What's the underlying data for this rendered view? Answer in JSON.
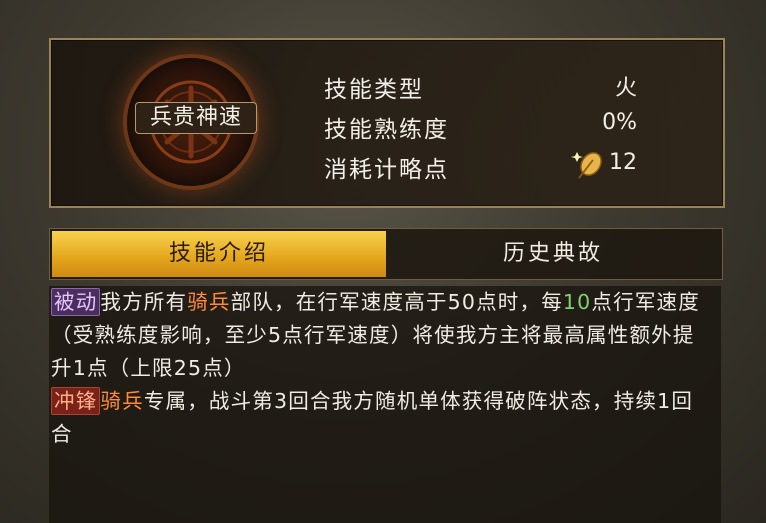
{
  "skill": {
    "name": "兵贵神速",
    "stats": [
      {
        "label": "技能类型",
        "value": "火"
      },
      {
        "label": "技能熟练度",
        "value": "0%"
      },
      {
        "label": "消耗计略点",
        "value": "12"
      }
    ],
    "cost_icon": "strategy-point-feather-icon"
  },
  "tabs": {
    "active": "技能介绍",
    "other": "历史典故"
  },
  "description": {
    "passive_tag": "被动",
    "line1_a": "我方所有",
    "line1_kw": "骑兵",
    "line1_b": "部队，在行军速度高于50点时，每",
    "line1_num": "10",
    "line1_c": "点行军速度（受熟练度影响，至少5点行军速度）将使我方主将最高属性额外提升1点（上限25点）",
    "charge_tag": "冲锋",
    "line2_kw": "骑兵",
    "line2_b": "专属，战斗第3回合我方随机单体获得破阵状态，持续1回合"
  },
  "colors": {
    "tab_active": "#f0b830",
    "keyword_orange": "#ff8a3a",
    "keyword_green": "#7fd36b",
    "passive_tag": "#4a2e5e",
    "charge_tag": "#7a2218"
  }
}
